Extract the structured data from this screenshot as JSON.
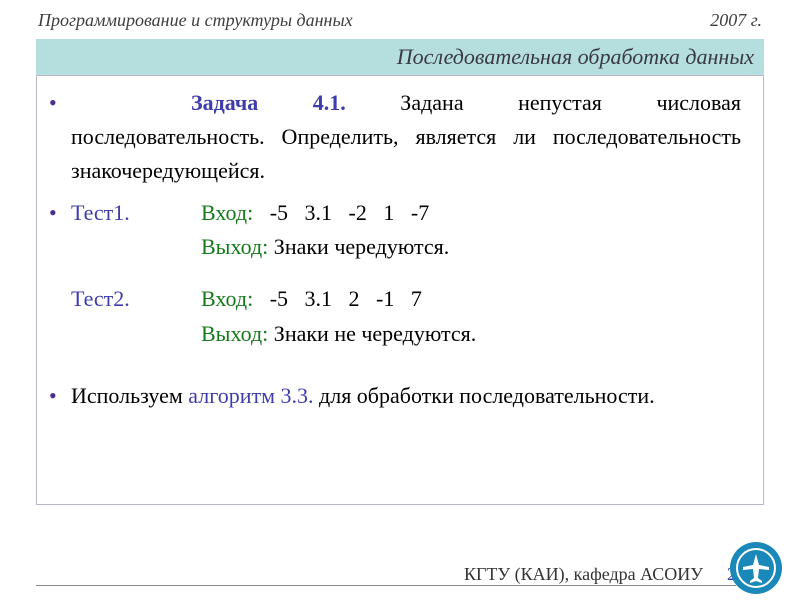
{
  "header": {
    "left": "Программирование  и структуры данных",
    "right": "2007 г."
  },
  "title": "Последовательная обработка данных",
  "task": {
    "label": "Задача 4.1.",
    "text": "Задана непустая числовая последовательность. Определить, является ли последовательность знакочередующейся."
  },
  "tests": [
    {
      "name": "Тест1.",
      "in_label": "Вход:",
      "in_values": "-5   3.1   -2   1   -7",
      "out_label": "Выход:",
      "out_text": "Знаки чередуются."
    },
    {
      "name": "Тест2.",
      "in_label": "Вход:",
      "in_values": "-5   3.1   2   -1   7",
      "out_label": "Выход:",
      "out_text": "Знаки не чередуются."
    }
  ],
  "algo": {
    "prefix": "Используем",
    "label": "алгоритм 3.3.",
    "suffix": "для обработки последовательности."
  },
  "footer": {
    "org": "КГТУ  (КАИ),  кафедра АСОИУ",
    "page": "2"
  },
  "icon": "airplane-icon"
}
